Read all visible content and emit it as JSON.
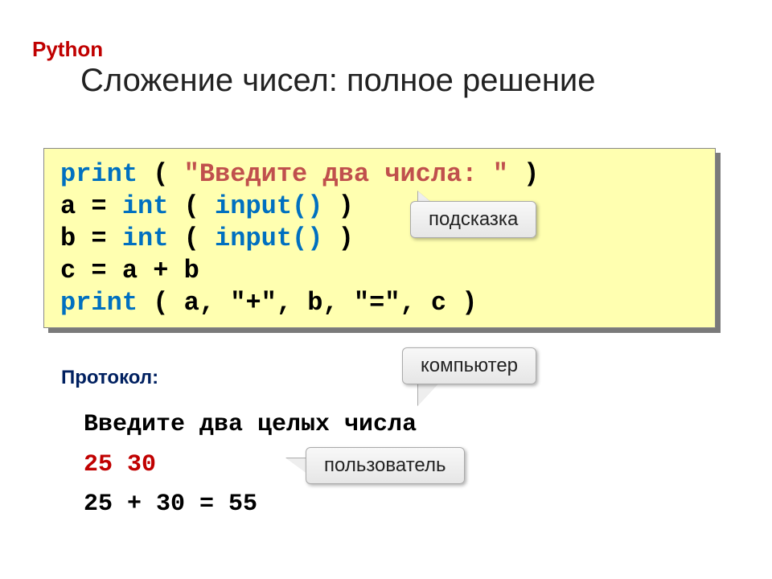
{
  "lang_label": "Python",
  "title": "Сложение чисел: полное решение",
  "code": {
    "l1_kw": "print",
    "l1_paren_open": " ( ",
    "l1_str": "\"Введите два числа: \"",
    "l1_paren_close": " )",
    "l2_pre": "a = ",
    "l2_kw": "int",
    "l2_mid": " ( ",
    "l2_kw2": "input()",
    "l2_post": " )",
    "l3_pre": "b = ",
    "l3_kw": "int",
    "l3_mid": " ( ",
    "l3_kw2": "input()",
    "l3_post": " )",
    "l4": "c = a + b",
    "l5_kw": "print",
    "l5_rest": " ( a, \"+\", b, \"=\", c )"
  },
  "hints": {
    "hint1": "подсказка",
    "hint2": "компьютер",
    "hint3": "пользователь"
  },
  "protocol_label": "Протокол:",
  "protocol": {
    "prompt": "Введите два целых числа",
    "user_input": "25 30",
    "result": "25 + 30 = 55"
  }
}
